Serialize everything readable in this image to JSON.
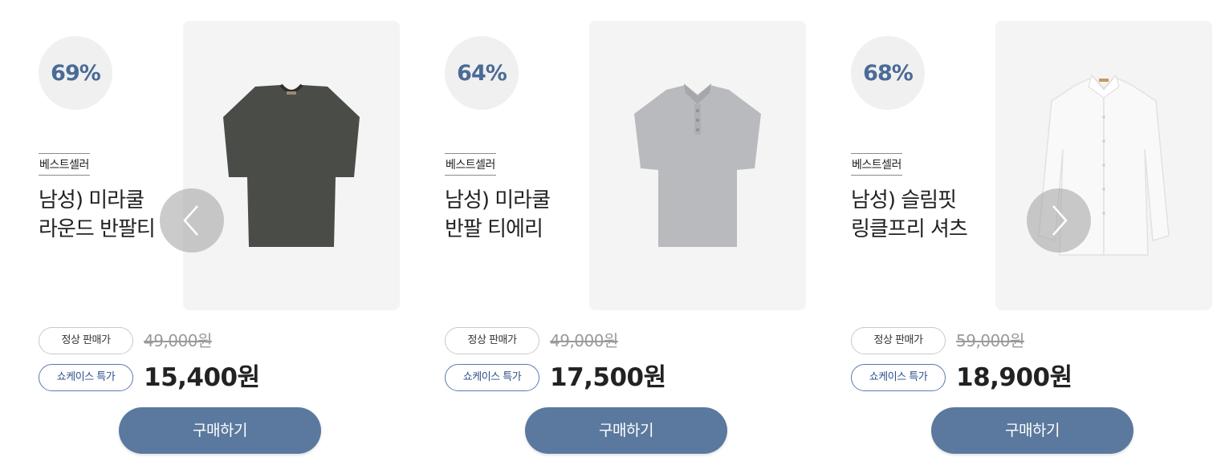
{
  "products": [
    {
      "discount": "69%",
      "tag": "베스트셀러",
      "title_lines": [
        "남성) 미라쿨",
        "라운드 반팔티"
      ],
      "orig_label": "정상 판매가",
      "orig_price": "49,000원",
      "sale_label": "쇼케이스 특가",
      "sale_price": "15,400원",
      "buy_label": "구매하기",
      "image_icon": "dark-tshirt",
      "shirt_color": "#4a4c48"
    },
    {
      "discount": "64%",
      "tag": "베스트셀러",
      "title_lines": [
        "남성) 미라쿨",
        "반팔 티에리"
      ],
      "orig_label": "정상 판매가",
      "orig_price": "49,000원",
      "sale_label": "쇼케이스 특가",
      "sale_price": "17,500원",
      "buy_label": "구매하기",
      "image_icon": "gray-polo-shirt",
      "shirt_color": "#b9babd"
    },
    {
      "discount": "68%",
      "tag": "베스트셀러",
      "title_lines": [
        "남성) 슬림핏",
        "링클프리 셔츠"
      ],
      "orig_label": "정상 판매가",
      "orig_price": "59,000원",
      "sale_label": "쇼케이스 특가",
      "sale_price": "18,900원",
      "buy_label": "구매하기",
      "image_icon": "white-dress-shirt",
      "shirt_color": "#f7f7f7"
    }
  ],
  "carousel": {
    "prev_icon": "chevron-left-icon",
    "next_icon": "chevron-right-icon"
  },
  "colors": {
    "accent": "#4a6b96",
    "button": "#5b799e",
    "badge_bg": "#f0f0f0",
    "image_bg": "#f4f4f4"
  }
}
